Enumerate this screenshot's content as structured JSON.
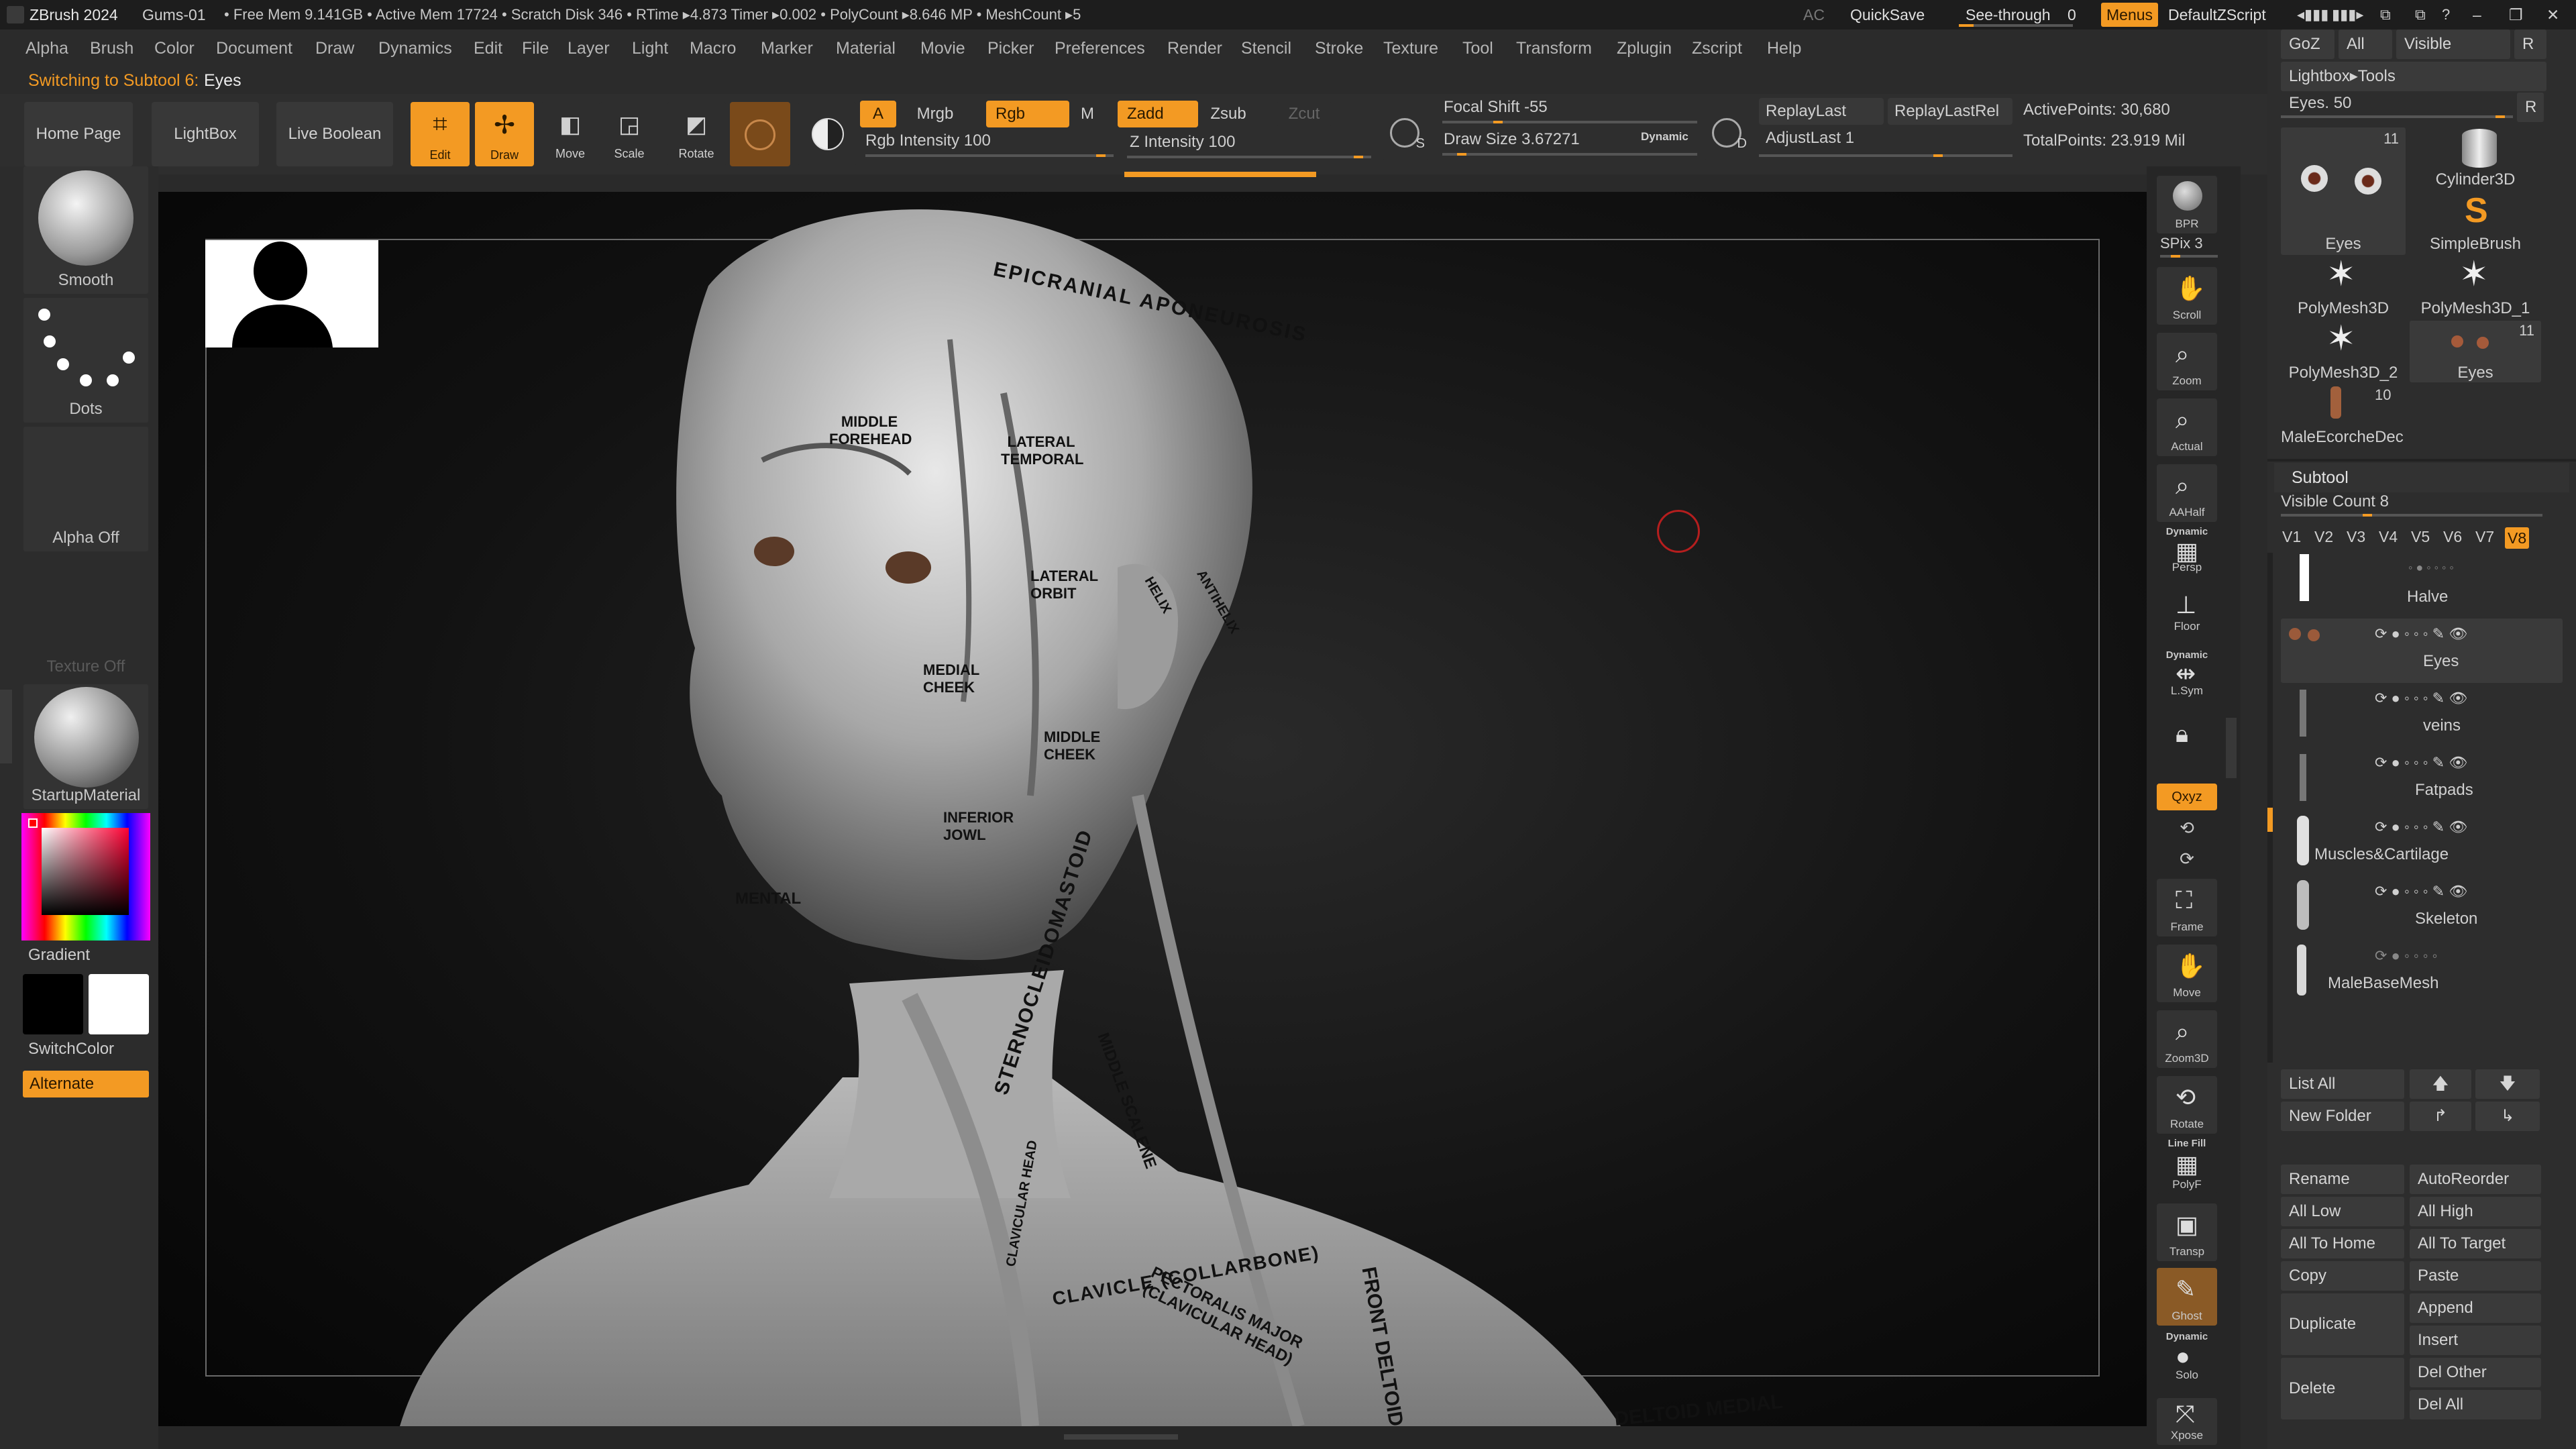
{
  "titlebar": {
    "app": "ZBrush 2024",
    "doc": "Gums-01",
    "status": "• Free Mem 9.141GB • Active Mem 17724 • Scratch Disk 346 • RTime ▸4.873 Timer ▸0.002 • PolyCount ▸8.646 MP • MeshCount ▸5",
    "ac": "AC",
    "quicksave": "QuickSave",
    "seethrough": "See-through",
    "seethrough_value": "0",
    "menus": "Menus",
    "script": "DefaultZScript"
  },
  "menubar": [
    "Alpha",
    "Brush",
    "Color",
    "Document",
    "Draw",
    "Dynamics",
    "Edit",
    "File",
    "Layer",
    "Light",
    "Macro",
    "Marker",
    "Material",
    "Movie",
    "Picker",
    "Preferences",
    "Render",
    "Stencil",
    "Stroke",
    "Texture",
    "Tool",
    "Transform",
    "Zplugin",
    "Zscript",
    "Help"
  ],
  "notice": {
    "prefix": "Switching to Subtool 6:",
    "name": "Eyes"
  },
  "toolbar": {
    "home": "Home Page",
    "lightbox": "LightBox",
    "liveboolean": "Live Boolean",
    "edit": "Edit",
    "draw": "Draw",
    "move": "Move",
    "scale": "Scale",
    "rotate": "Rotate",
    "a": "A",
    "mrgb": "Mrgb",
    "rgb": "Rgb",
    "m": "M",
    "rgb_intensity": "Rgb Intensity 100",
    "zadd": "Zadd",
    "zsub": "Zsub",
    "zcut": "Zcut",
    "z_intensity": "Z Intensity 100",
    "s": "S",
    "focal_shift": "Focal Shift -55",
    "draw_size": "Draw Size 3.67271",
    "dynamic": "Dynamic",
    "d": "D",
    "replay_last": "ReplayLast",
    "replay_last_rel": "ReplayLastRel",
    "adjust_last": "AdjustLast 1",
    "active_points": "ActivePoints: 30,680",
    "total_points": "TotalPoints: 23.919 Mil"
  },
  "left_shelf": {
    "brush": "Smooth",
    "stroke": "Dots",
    "alpha": "Alpha Off",
    "texture": "Texture Off",
    "material": "StartupMaterial",
    "gradient": "Gradient",
    "switchcolor": "SwitchColor",
    "alternate": "Alternate"
  },
  "right_shelf": {
    "bpr": "BPR",
    "spix": "SPix 3",
    "scroll": "Scroll",
    "zoom": "Zoom",
    "actual": "Actual",
    "aahalf": "AAHalf",
    "persp_dynamic": "Dynamic",
    "persp": "Persp",
    "floor": "Floor",
    "lsym_dynamic": "Dynamic",
    "lsym": "L.Sym",
    "xyz": "Qxyz",
    "frame": "Frame",
    "move": "Move",
    "zoom3d": "Zoom3D",
    "rotate": "Rotate",
    "linefill": "Line Fill",
    "polyf": "PolyF",
    "transp": "Transp",
    "ghost": "Ghost",
    "solo_dynamic": "Dynamic",
    "solo": "Solo",
    "xpose": "Xpose"
  },
  "canvas_labels": [
    "EPICRANIAL APONEUROSIS",
    "MIDDLE FOREHEAD",
    "LATERAL TEMPORAL",
    "LATERAL ORBIT",
    "MIDDLE CHEEK",
    "INFERIOR JOWL",
    "MEDIAL CHEEK",
    "MENTAL",
    "STERNOCLEIDOMASTOID",
    "MIDDLE SCALENE",
    "CLAVICULAR HEAD",
    "CLAVICLE (COLLARBONE)",
    "PECTORALIS MAJOR (CLAVICULAR HEAD)",
    "FRONT DELTOID",
    "DELTOID MEDIAL",
    "HELIX",
    "ANTIHELIX"
  ],
  "tray": {
    "goz": "GoZ",
    "all": "All",
    "visible": "Visible",
    "r": "R",
    "lightbox_tools": "Lightbox▸Tools",
    "eyes_slider": "Eyes. 50",
    "r2": "R",
    "tools": [
      {
        "name": "Eyes",
        "count": "11"
      },
      {
        "name": "Cylinder3D",
        "count": ""
      },
      {
        "name": "SimpleBrush",
        "count": ""
      },
      {
        "name": "PolyMesh3D",
        "count": ""
      },
      {
        "name": "PolyMesh3D_1",
        "count": ""
      },
      {
        "name": "PolyMesh3D_2",
        "count": ""
      },
      {
        "name": "Eyes",
        "count": "11"
      },
      {
        "name": "MaleEcorcheDec",
        "count": "10"
      }
    ],
    "subtool_header": "Subtool",
    "visible_count": "Visible Count 8",
    "versions": [
      "V1",
      "V2",
      "V3",
      "V4",
      "V5",
      "V6",
      "V7",
      "V8"
    ],
    "subtools": [
      "Halve",
      "Eyes",
      "veins",
      "Fatpads",
      "Muscles&Cartilage",
      "Skeleton",
      "MaleBaseMesh"
    ],
    "list_all": "List All",
    "new_folder": "New Folder",
    "rename": "Rename",
    "autoreorder": "AutoReorder",
    "all_low": "All Low",
    "all_high": "All High",
    "all_to_home": "All To Home",
    "all_to_target": "All To Target",
    "copy": "Copy",
    "paste": "Paste",
    "duplicate": "Duplicate",
    "append": "Append",
    "insert": "Insert",
    "delete": "Delete",
    "del_other": "Del Other",
    "del_all": "Del All"
  }
}
